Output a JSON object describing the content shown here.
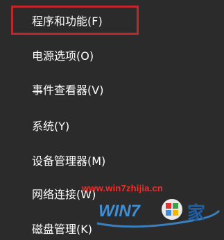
{
  "menu": {
    "items": [
      {
        "label": "程序和功能(F)",
        "highlighted": true
      },
      {
        "label": "电源选项(O)"
      },
      {
        "label": "事件查看器(V)"
      },
      {
        "label": "系统(Y)"
      },
      {
        "label": "设备管理器(M)"
      },
      {
        "label": "网络连接(W)"
      },
      {
        "label": "磁盘管理(K)"
      }
    ]
  },
  "watermark": {
    "url": "www.win7zhijia.cn",
    "brand_text": "WIN7",
    "brand_char": "家",
    "colors": {
      "url": "#e8322f",
      "logo": "#3e8fd6",
      "logo_dark": "#1d5fa8"
    }
  },
  "colors": {
    "background": "#2b2b2b",
    "text": "#ffffff",
    "highlight_border": "#c0272d"
  }
}
